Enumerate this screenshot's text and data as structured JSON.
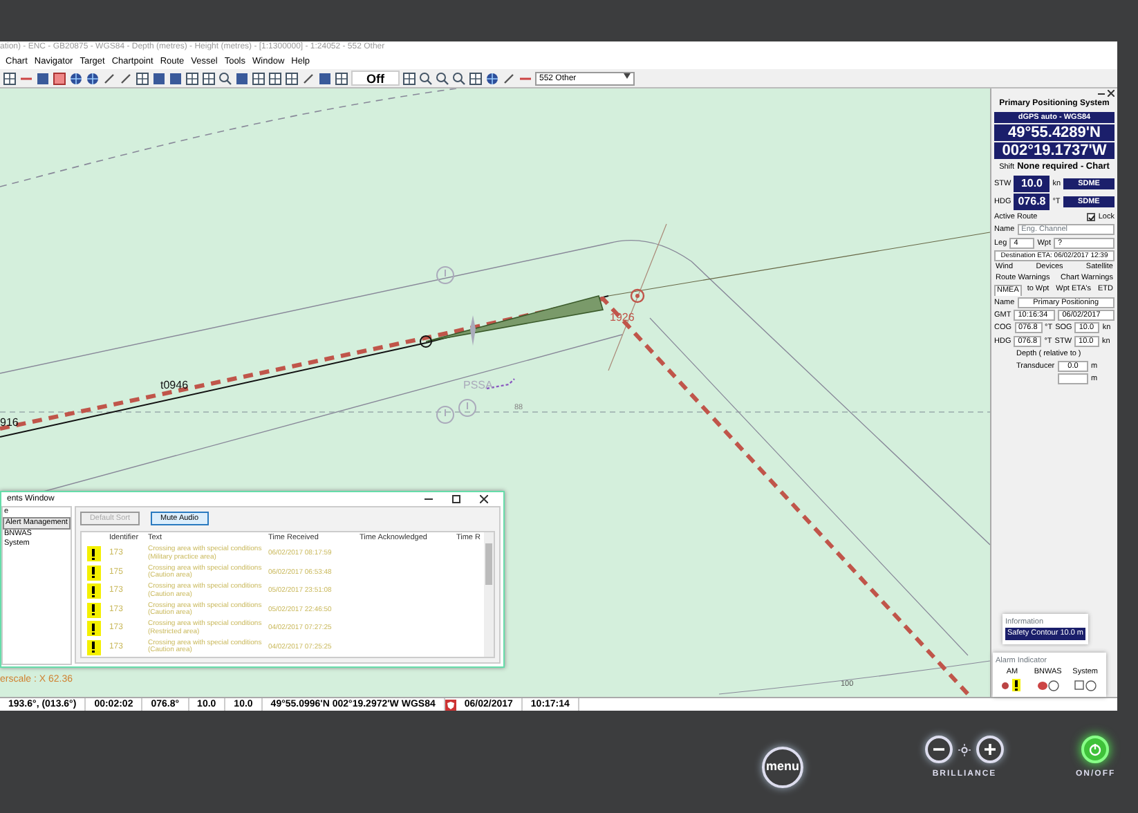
{
  "window": {
    "title": "ation) - ENC - GB20875 - WGS84 - Depth (metres) - Height (metres) - [1:1300000] - 1:24052 - 552 Other"
  },
  "menu": [
    "Chart",
    "Navigator",
    "Target",
    "Chartpoint",
    "Route",
    "Vessel",
    "Tools",
    "Window",
    "Help"
  ],
  "toolbar": {
    "toggle": "Off",
    "layer_dropdown": "552 Other"
  },
  "chart": {
    "labels": [
      {
        "kind": "track",
        "text": "t0946"
      },
      {
        "kind": "track",
        "text": "916"
      },
      {
        "kind": "waypoint",
        "text": "1926"
      },
      {
        "kind": "area",
        "text": "PSSA"
      },
      {
        "kind": "sounding",
        "text": "88"
      },
      {
        "kind": "sounding",
        "text": "100"
      },
      {
        "kind": "scale",
        "text": "erscale : X 62.36"
      }
    ]
  },
  "alerts_window": {
    "title": "ents Window",
    "tree": [
      {
        "label": "e",
        "selected": false
      },
      {
        "label": "Alert Management",
        "selected": true
      },
      {
        "label": "BNWAS",
        "selected": false
      },
      {
        "label": "System",
        "selected": false
      }
    ],
    "buttons": [
      {
        "label": "Default Sort",
        "disabled": true
      },
      {
        "label": "Mute Audio",
        "disabled": false
      }
    ],
    "columns": [
      "Identifier",
      "Text",
      "Time Received",
      "Time Acknowledged",
      "Time R"
    ],
    "rows": [
      {
        "identifier": "173",
        "text": "Crossing area with special conditions (Military practice area)",
        "time_received": "06/02/2017 08:17:59"
      },
      {
        "identifier": "175",
        "text": "Crossing area with special conditions (Caution area)",
        "time_received": "06/02/2017 06:53:48"
      },
      {
        "identifier": "173",
        "text": "Crossing area with special conditions (Caution area)",
        "time_received": "05/02/2017 23:51:08"
      },
      {
        "identifier": "173",
        "text": "Crossing area with special conditions (Caution area)",
        "time_received": "05/02/2017 22:46:50"
      },
      {
        "identifier": "173",
        "text": "Crossing area with special conditions (Restricted area)",
        "time_received": "04/02/2017 07:27:25"
      },
      {
        "identifier": "173",
        "text": "Crossing area with special conditions (Caution area)",
        "time_received": "04/02/2017 07:25:25"
      }
    ]
  },
  "positioning_panel": {
    "title": "Primary Positioning System",
    "source": "dGPS auto - WGS84",
    "latitude": "49°55.4289'N",
    "longitude": "002°19.1737'W",
    "shift_label": "Shift",
    "shift_value": "None required - Chart",
    "stw": {
      "label": "STW",
      "value": "10.0",
      "unit": "kn",
      "source": "SDME"
    },
    "hdg": {
      "label": "HDG",
      "value": "076.8",
      "unit": "°T",
      "source": "SDME"
    },
    "active_route": "Active Route",
    "lock": {
      "label": "Lock",
      "checked": true
    },
    "route_name_label": "Name",
    "route_name": "Eng. Channel",
    "leg_label": "Leg",
    "leg": "4",
    "wpt_label": "Wpt",
    "wpt": "?",
    "destination_eta": "Destination ETA: 06/02/2017 12:39",
    "tabs": [
      {
        "label": "Wind",
        "selected": false
      },
      {
        "label": "Devices",
        "selected": false
      },
      {
        "label": "Satellite",
        "selected": false
      },
      {
        "label": "Route Warnings",
        "selected": false
      },
      {
        "label": "Chart Warnings",
        "selected": false
      },
      {
        "label": "NMEA",
        "selected": true
      },
      {
        "label": "to Wpt",
        "selected": false
      },
      {
        "label": "Wpt ETA's",
        "selected": false
      },
      {
        "label": "ETD",
        "selected": false
      }
    ],
    "name_label": "Name",
    "name": "Primary Positioning",
    "gmt_label": "GMT",
    "gmt_time": "10:16:34",
    "gmt_date": "06/02/2017",
    "cog_label": "COG",
    "cog": "076.8",
    "cog_unit": "°T",
    "sog_label": "SOG",
    "sog": "10.0",
    "sog_unit": "kn",
    "hdg2_label": "HDG",
    "hdg2": "076.8",
    "hdg2_unit": "°T",
    "stw2_label": "STW",
    "stw2": "10.0",
    "stw2_unit": "kn",
    "depth_label": "Depth ( relative to )",
    "transducer_label": "Transducer",
    "transducer": "0.0",
    "transducer_unit": "m",
    "depth2_unit": "m"
  },
  "information": {
    "title": "Information",
    "message": "Safety Contour 10.0 m"
  },
  "alarm_indicator": {
    "title": "Alarm Indicator",
    "groups": [
      "AM",
      "BNWAS",
      "System"
    ]
  },
  "status_bar": [
    "193.6°, (013.6°)",
    "00:02:02",
    "076.8°",
    "10.0",
    "10.0",
    "49°55.0996'N 002°19.2972'W WGS84",
    "06/02/2017",
    "10:17:14"
  ],
  "bezel": {
    "menu": "menu",
    "brilliance": "BRILLIANCE",
    "power": "ON/OFF"
  }
}
